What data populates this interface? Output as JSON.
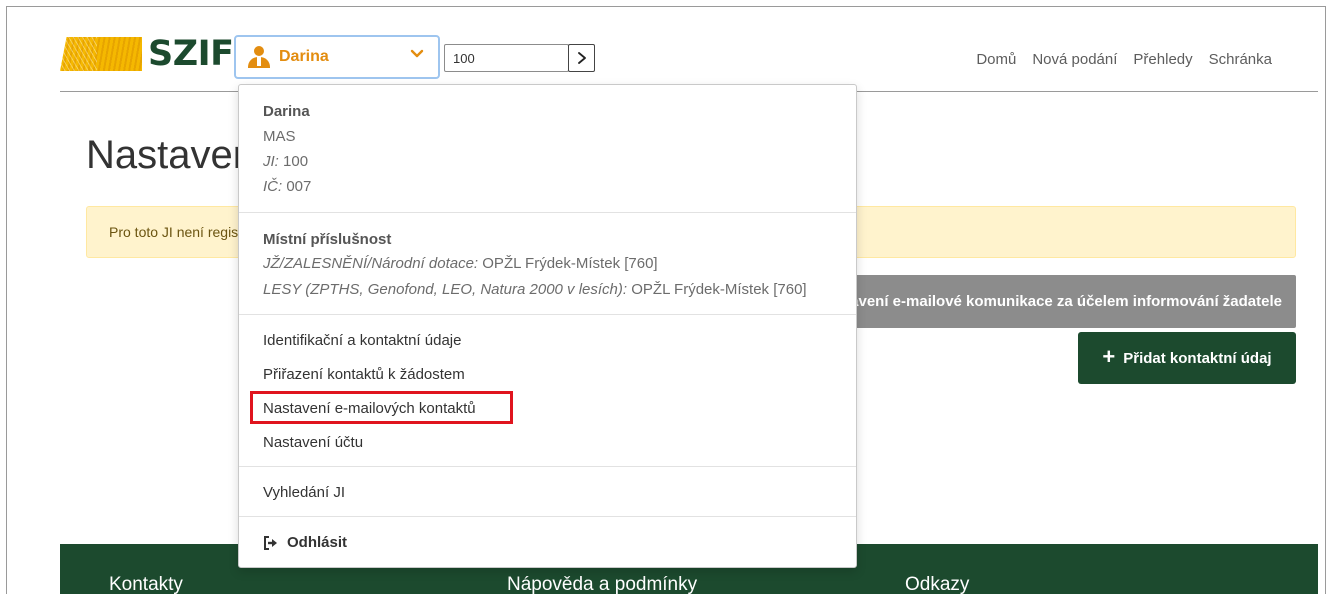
{
  "header": {
    "logo_text": "SZIF",
    "user": {
      "name": "Darina"
    },
    "ji_input": {
      "value": "100"
    },
    "nav": [
      "Domů",
      "Nová podání",
      "Přehledy",
      "Schránka"
    ]
  },
  "page": {
    "title": "Nastavení e-mailových kontaktů",
    "alert": "Pro toto JI není registrován žádný e-mailový kontakt",
    "grey_button": "Nastavení e-mailové komunikace za účelem informování žadatele",
    "add_button": "Přidat kontaktní údaj"
  },
  "dropdown": {
    "profile": {
      "name": "Darina",
      "type": "MAS",
      "ji_label": "JI:",
      "ji_value": "100",
      "ic_label": "IČ:",
      "ic_value": "007"
    },
    "locality": {
      "heading": "Místní příslušnost",
      "rows": [
        {
          "label": "JŽ/ZALESNĚNÍ/Národní dotace:",
          "value": "OPŽL Frýdek-Místek [760]"
        },
        {
          "label": "LESY (ZPTHS, Genofond, LEO, Natura 2000 v lesích):",
          "value": "OPŽL Frýdek-Místek [760]"
        }
      ]
    },
    "menu": [
      "Identifikační a kontaktní údaje",
      "Přiřazení kontaktů k žádostem",
      "Nastavení e-mailových kontaktů",
      "Nastavení účtu"
    ],
    "search": "Vyhledání JI",
    "logout": "Odhlásit"
  },
  "footer": {
    "columns": [
      "Kontakty",
      "Nápověda a podmínky",
      "Odkazy"
    ]
  },
  "colors": {
    "brand_green": "#1c4a2e",
    "accent_orange": "#e38d10",
    "highlight_red": "#e0141e",
    "alert_bg": "#fff3cd"
  }
}
